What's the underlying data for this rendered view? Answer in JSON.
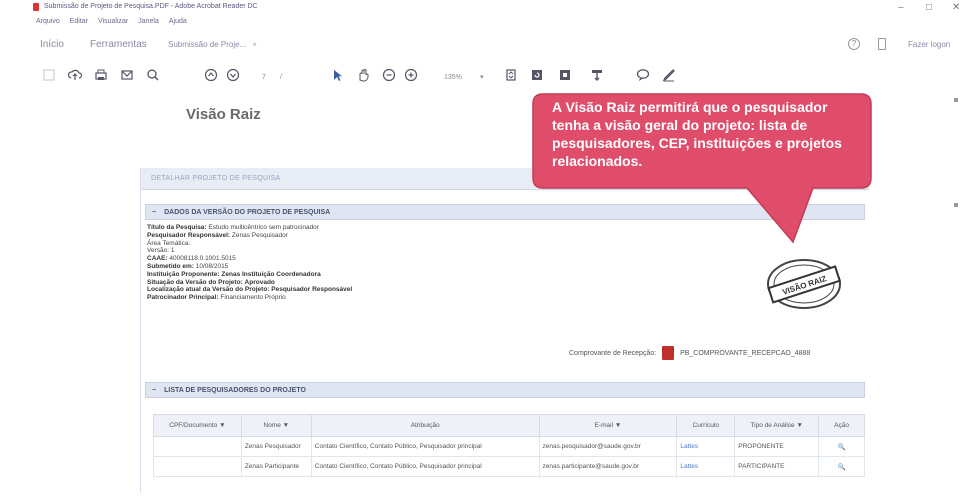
{
  "window": {
    "title": "Submissão de Projeto de Pesquisa.PDF - Adobe Acrobat Reader DC",
    "minimize": "–",
    "restore": "□",
    "close": "✕"
  },
  "menu": [
    "Arquivo",
    "Editar",
    "Visualizar",
    "Janela",
    "Ajuda"
  ],
  "tabs": {
    "home": "Início",
    "tools": "Ferramentas",
    "document": "Submissão de Proje...",
    "close": "×"
  },
  "header_right": {
    "help": "?",
    "login": "Fazer logon"
  },
  "toolbar": {
    "page_current": "7",
    "page_sep": "/",
    "zoom": "135%",
    "zoom_arrow": "▾",
    "icons": [
      "bookmark-icon",
      "upload-icon",
      "print-icon",
      "email-icon",
      "search-icon",
      "page-up-icon",
      "page-down-icon",
      "select-pointer-icon",
      "hand-icon",
      "zoom-out-icon",
      "zoom-in-icon",
      "fit-page-icon",
      "rotate-icon",
      "fullscreen-icon",
      "highlight-icon",
      "comment-icon",
      "sign-icon"
    ]
  },
  "heading": "Visão Raiz",
  "callout": "A Visão Raiz permitirá que o pesquisador tenha a visão geral do projeto: lista de pesquisadores, CEP, instituições e projetos relacionados.",
  "doc": {
    "topbar": "DETALHAR PROJETO DE PESQUISA",
    "section1": "DADOS DA VERSÃO DO PROJETO DE PESQUISA",
    "details": [
      {
        "label": "Título da Pesquisa:",
        "value": "Estudo multicêntrico sem patrocinador"
      },
      {
        "label": "Pesquisador Responsável:",
        "value": "Zenas Pesquisador"
      },
      {
        "label": "",
        "value": "Área Temática:"
      },
      {
        "label": "",
        "value": "Versão: 1"
      },
      {
        "label": "CAAE:",
        "value": "40008118.0.1001.5015"
      },
      {
        "label": "Submetido em:",
        "value": "10/08/2015"
      },
      {
        "label": "Instituição Proponente:",
        "value": "Zenas Instituição Coordenadora"
      },
      {
        "label": "Situação da Versão do Projeto:",
        "value": "Aprovado"
      },
      {
        "label": "Localização atual da Versão do Projeto:",
        "value": "Pesquisador Responsável"
      },
      {
        "label": "Patrocinador Principal:",
        "value": "Financiamento Próprio"
      }
    ],
    "stamp_text": "VISÃO RAIZ",
    "receipt_label": "Comprovante de Recepção:",
    "receipt_file": "PB_COMPROVANTE_RECEPCAO_4888",
    "section2": "LISTA DE PESQUISADORES DO PROJETO",
    "table": {
      "headers": [
        "CPF/Documento ▼",
        "Nome ▼",
        "Atribuição",
        "E-mail ▼",
        "Currículo",
        "Tipo de Análise ▼",
        "Ação"
      ],
      "rows": [
        [
          "",
          "Zenas Pesquisador",
          "Contato Científico, Contato Público, Pesquisador principal",
          "zenas.pesquisador@saude.gov.br",
          "Lattes",
          "PROPONENTE",
          "🔍"
        ],
        [
          "",
          "Zenas Participante",
          "Contato Científico, Contato Público, Pesquisador principal",
          "zenas.participante@saude.gov.br",
          "Lattes",
          "PARTICIPANTE",
          "🔍"
        ]
      ]
    }
  }
}
